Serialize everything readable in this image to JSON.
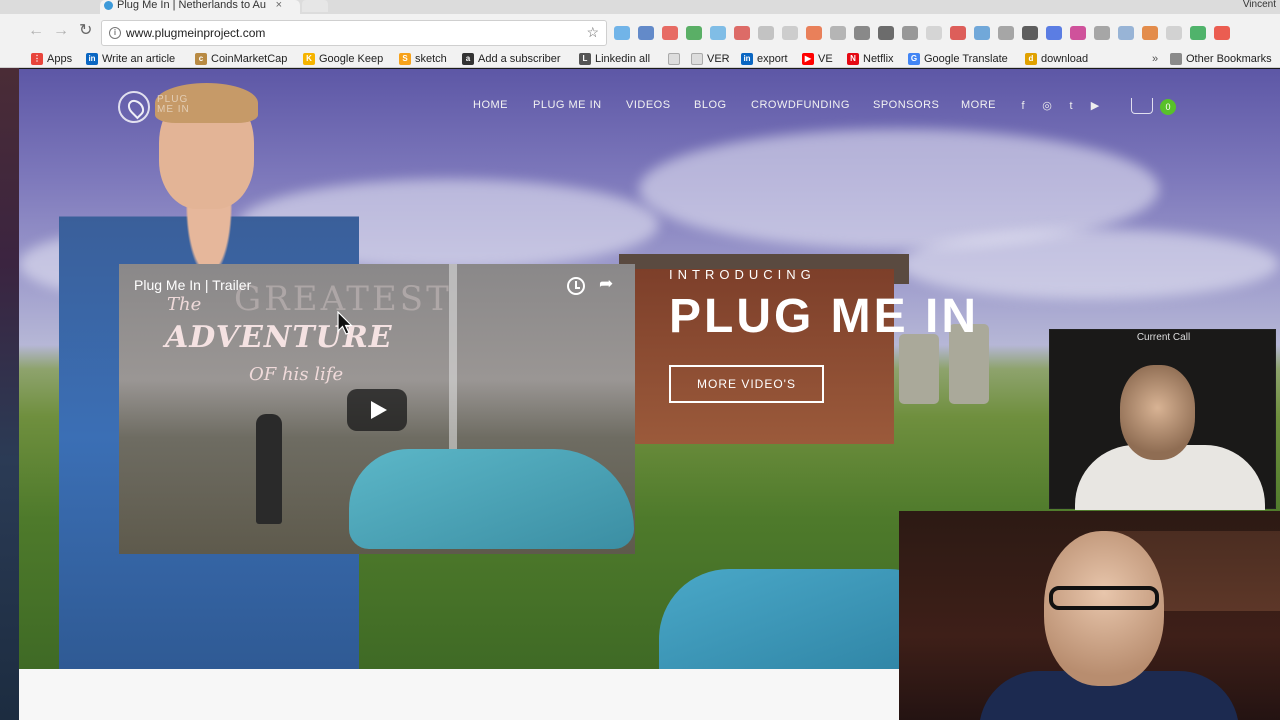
{
  "browser": {
    "tab_title": "Plug Me In | Netherlands to Au",
    "tab_close": "×",
    "profile_name": "Vincent",
    "url": "www.plugmeinproject.com",
    "star": "☆",
    "back": "←",
    "forward": "→",
    "reload": "↻"
  },
  "bookmarks": [
    {
      "label": "Apps",
      "icon_color": "#e8453c",
      "icon_text": "⋮"
    },
    {
      "label": "Write an article",
      "icon_color": "#0a66c2",
      "icon_text": "in"
    },
    {
      "label": "CoinMarketCap",
      "icon_color": "#b88a43",
      "icon_text": "c"
    },
    {
      "label": "Google Keep",
      "icon_color": "#f6b400",
      "icon_text": "K"
    },
    {
      "label": "sketch",
      "icon_color": "#f7a21b",
      "icon_text": "S"
    },
    {
      "label": "Add a subscriber",
      "icon_color": "#333333",
      "icon_text": "a"
    },
    {
      "label": "Linkedin all",
      "icon_color": "#555555",
      "icon_text": "L"
    },
    {
      "label": "",
      "icon_color": "#999999",
      "icon_text": ""
    },
    {
      "label": "VER",
      "icon_color": "#9aa0a6",
      "icon_text": ""
    },
    {
      "label": "export",
      "icon_color": "#0a66c2",
      "icon_text": "in"
    },
    {
      "label": "VE",
      "icon_color": "#ff0000",
      "icon_text": "▶"
    },
    {
      "label": "Netflix",
      "icon_color": "#e50914",
      "icon_text": "N"
    },
    {
      "label": "Google Translate",
      "icon_color": "#4285f4",
      "icon_text": "G"
    },
    {
      "label": "download",
      "icon_color": "#e0a100",
      "icon_text": "d"
    }
  ],
  "bookmarks_overflow": "»",
  "other_bookmarks": "Other Bookmarks",
  "site": {
    "logo_text_line1": "PLUG",
    "logo_text_line2": "ME IN",
    "nav": [
      "HOME",
      "PLUG ME IN",
      "VIDEOS",
      "BLOG",
      "CROWDFUNDING",
      "SPONSORS",
      "MORE"
    ],
    "social": [
      "f",
      "◎",
      "t",
      "▶"
    ],
    "cart_count": "0",
    "intro": "INTRODUCING",
    "hero_title": "PLUG ME IN",
    "cta": "MORE VIDEO'S"
  },
  "video": {
    "title": "Plug Me In | Trailer",
    "share": "➦",
    "text_the": "The",
    "text_greatest": "GREATEST",
    "text_adventure": "ADVENTURE",
    "text_of_his_life": "OF his life"
  },
  "call": {
    "label": "Current Call"
  }
}
